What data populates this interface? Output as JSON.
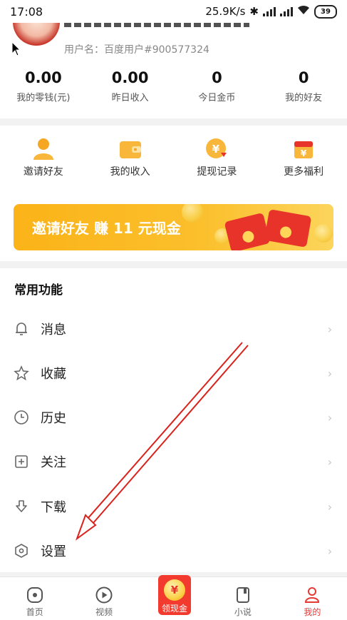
{
  "status_bar": {
    "time": "17:08",
    "speed": "25.9K/s",
    "battery": "39"
  },
  "profile": {
    "user_id": "用户名：百度用户#900577324"
  },
  "stats": [
    {
      "value": "0.00",
      "label": "我的零钱(元)"
    },
    {
      "value": "0.00",
      "label": "昨日收入"
    },
    {
      "value": "0",
      "label": "今日金币"
    },
    {
      "value": "0",
      "label": "我的好友"
    }
  ],
  "quick_actions": [
    {
      "label": "邀请好友",
      "icon": "person-icon"
    },
    {
      "label": "我的收入",
      "icon": "wallet-icon"
    },
    {
      "label": "提现记录",
      "icon": "yuan-coin-icon"
    },
    {
      "label": "更多福利",
      "icon": "gift-icon"
    }
  ],
  "banner": {
    "text": "邀请好友 赚 11 元现金"
  },
  "section": {
    "title": "常用功能"
  },
  "menu": [
    {
      "label": "消息",
      "icon": "bell-icon"
    },
    {
      "label": "收藏",
      "icon": "star-icon"
    },
    {
      "label": "历史",
      "icon": "clock-icon"
    },
    {
      "label": "关注",
      "icon": "plus-square-icon"
    },
    {
      "label": "下载",
      "icon": "download-icon"
    },
    {
      "label": "设置",
      "icon": "settings-hexagon-icon"
    }
  ],
  "bottom_nav": [
    {
      "label": "首页",
      "icon": "home-icon"
    },
    {
      "label": "视频",
      "icon": "play-icon"
    },
    {
      "label": "领现金",
      "icon": "yuan-coin-icon"
    },
    {
      "label": "小说",
      "icon": "book-icon"
    },
    {
      "label": "我的",
      "icon": "profile-icon",
      "active": true
    }
  ],
  "cash_coin_symbol": "¥",
  "accent_color": "#e53935",
  "brand_yellow": "#fbb318"
}
